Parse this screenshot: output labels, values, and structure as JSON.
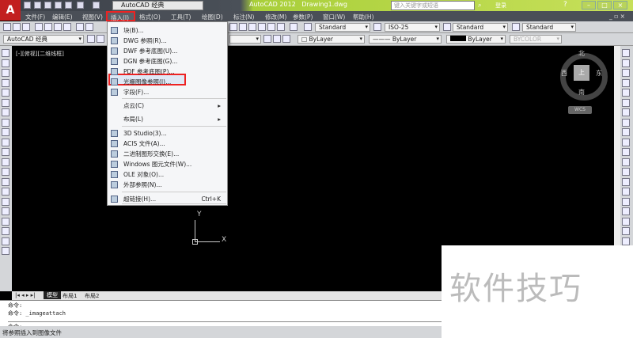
{
  "titlebar": {
    "workspace": "AutoCAD 经典",
    "app_title": "AutoCAD 2012",
    "doc_title": "Drawing1.dwg",
    "search_placeholder": "键入关键字或短语",
    "login": "登录"
  },
  "menubar": [
    "文件(F)",
    "编辑(E)",
    "视图(V)",
    "插入(I)",
    "格式(O)",
    "工具(T)",
    "绘图(D)",
    "标注(N)",
    "修改(M)",
    "参数(P)",
    "窗口(W)",
    "帮助(H)"
  ],
  "toolbar": {
    "text_style": "Standard",
    "dim_style": "ISO-25",
    "table_style": "Standard",
    "mleader_style": "Standard",
    "workspace": "AutoCAD 经典",
    "layer": "ByLayer",
    "linetype": "ByLayer",
    "lineweight": "ByLayer",
    "plotstyle": "BYCOLOR"
  },
  "viewport_label": "[-][俯视][二维线框]",
  "insert_menu": {
    "items": [
      {
        "label": "块(B)..."
      },
      {
        "label": "DWG 参照(R)..."
      },
      {
        "label": "DWF 参考底图(U)..."
      },
      {
        "label": "DGN 参考底图(G)..."
      },
      {
        "label": "PDF 参考底图(P)..."
      },
      {
        "label": "光栅图像参照(I)...",
        "highlighted": true
      },
      {
        "label": "字段(F)..."
      },
      {
        "label": "点云(C)",
        "submenu": true
      },
      {
        "label": "布局(L)",
        "submenu": true
      },
      {
        "label": "3D Studio(3)..."
      },
      {
        "label": "ACIS 文件(A)..."
      },
      {
        "label": "二进制图形交换(E)..."
      },
      {
        "label": "Windows 图元文件(W)..."
      },
      {
        "label": "OLE 对象(O)..."
      },
      {
        "label": "外部参照(N)..."
      },
      {
        "label": "超链接(H)...",
        "shortcut": "Ctrl+K"
      }
    ]
  },
  "viewcube": {
    "north": "北",
    "south": "南",
    "east": "东",
    "west": "西",
    "top": "上",
    "ucs": "WCS"
  },
  "ucs_axes": {
    "x": "X",
    "y": "Y"
  },
  "tabs": [
    "模型",
    "布局1",
    "布局2"
  ],
  "command": {
    "lines": [
      "命令:",
      "命令: _imageattach"
    ],
    "prompt": "命令:"
  },
  "status": "将参照插入到图像文件",
  "watermark": "软件技巧",
  "colors": {
    "highlight_box": "#e22222",
    "title_accent": "#a9cf3a"
  }
}
